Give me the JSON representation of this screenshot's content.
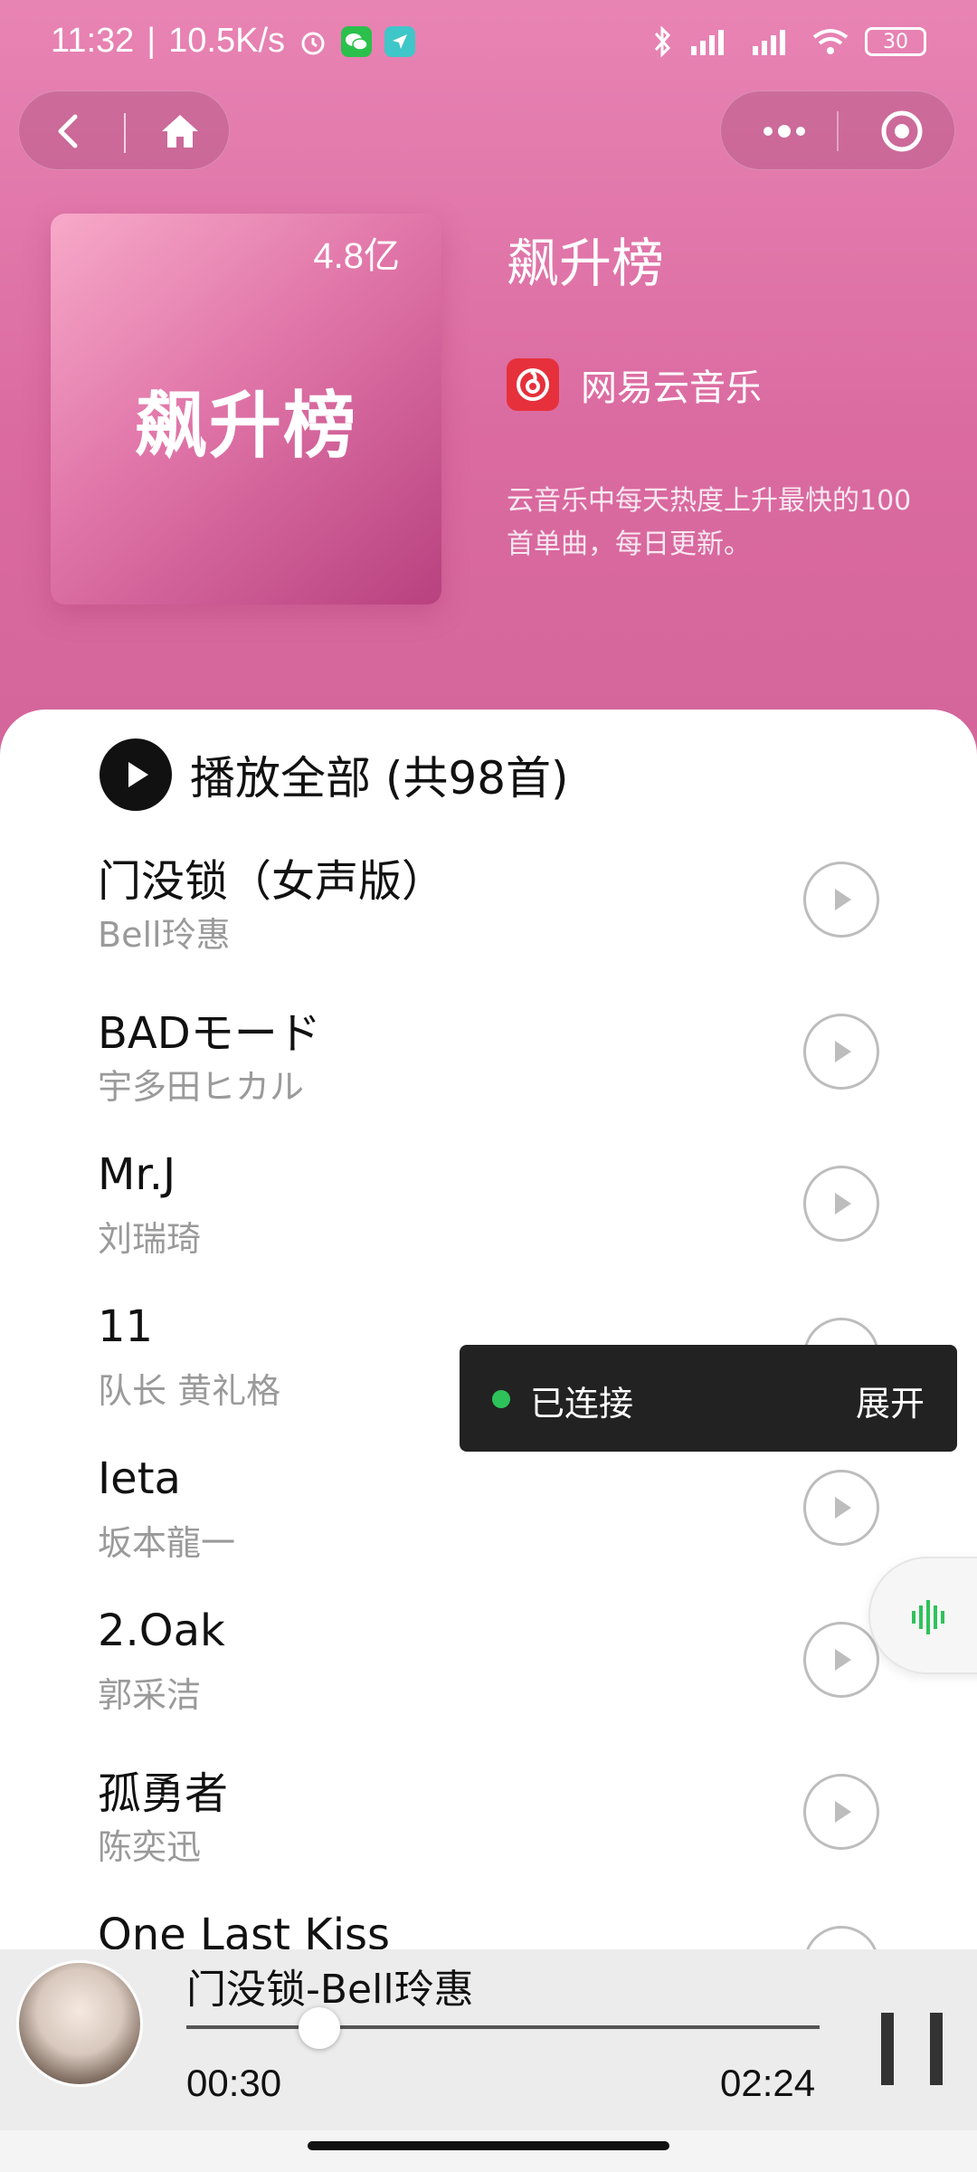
{
  "status_bar": {
    "time": "11:32",
    "net_speed": "10.5K/s",
    "battery": "30",
    "icons": [
      "alarm-icon",
      "wechat-icon",
      "location-icon",
      "bluetooth-icon",
      "signal-icon",
      "wifi-icon",
      "battery-icon"
    ]
  },
  "header": {
    "cover_plays": "4.8亿",
    "cover_title": "飙升榜",
    "title": "飙升榜",
    "source": "网易云音乐",
    "description": "云音乐中每天热度上升最快的100首单曲，每日更新。"
  },
  "play_all": {
    "label": "播放全部 (共98首)"
  },
  "songs": [
    {
      "name": "门没锁（女声版）",
      "artist": "Bell玲惠"
    },
    {
      "name": "BADモード",
      "artist": "宇多田ヒカル"
    },
    {
      "name": "Mr.J",
      "artist": "刘瑞琦"
    },
    {
      "name": "11",
      "artist": "队长 黄礼格"
    },
    {
      "name": "Ieta",
      "artist": "坂本龍一"
    },
    {
      "name": "2.Oak",
      "artist": "郭采洁"
    },
    {
      "name": "孤勇者",
      "artist": "陈奕迅"
    },
    {
      "name": "One Last Kiss",
      "artist": ""
    }
  ],
  "toast": {
    "status": "已连接",
    "action": "展开"
  },
  "player": {
    "now_playing": "门没锁-Bell玲惠",
    "current_time": "00:30",
    "total_time": "02:24",
    "progress": 0.21
  },
  "colors": {
    "hero": "#da6aa0",
    "accent_green": "#2ec25b",
    "netease_red": "#e6303b"
  }
}
